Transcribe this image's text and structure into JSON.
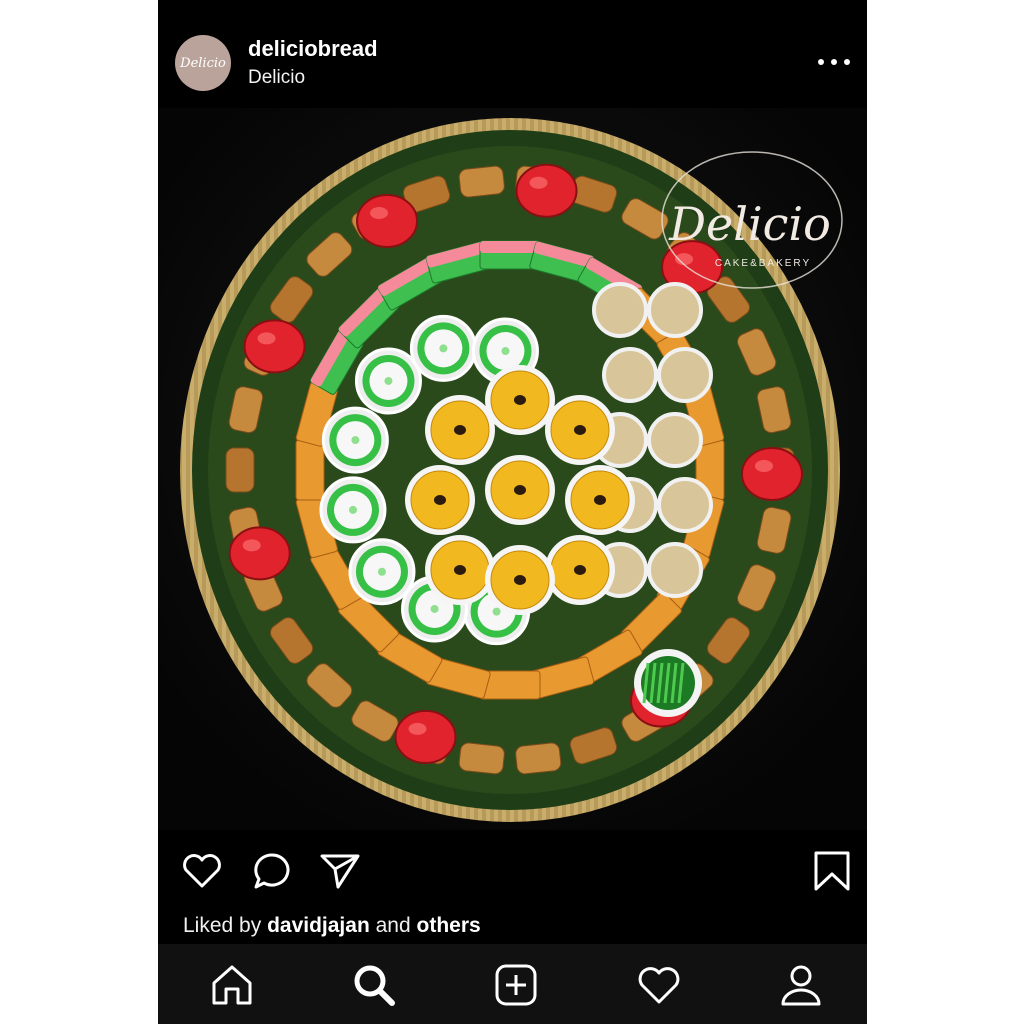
{
  "post": {
    "username": "deliciobread",
    "subtitle": "Delicio",
    "avatar_text": "Delicio",
    "watermark_text": "Delicio",
    "watermark_sub": "CAKE&BAKERY",
    "liked_prefix": "Liked by",
    "liked_user": "davidjajan",
    "liked_mid": "and",
    "liked_suffix": "others"
  },
  "icons": {
    "more": "more-horizontal-icon",
    "like": "heart-icon",
    "comment": "comment-icon",
    "share": "paper-plane-icon",
    "save": "bookmark-icon"
  },
  "nav": [
    "home-icon",
    "search-icon",
    "add-post-icon",
    "activity-heart-icon",
    "profile-icon"
  ],
  "colors": {
    "background": "#000000",
    "nav_background": "#111111",
    "avatar": "#b9a39a",
    "text": "#ffffff"
  }
}
